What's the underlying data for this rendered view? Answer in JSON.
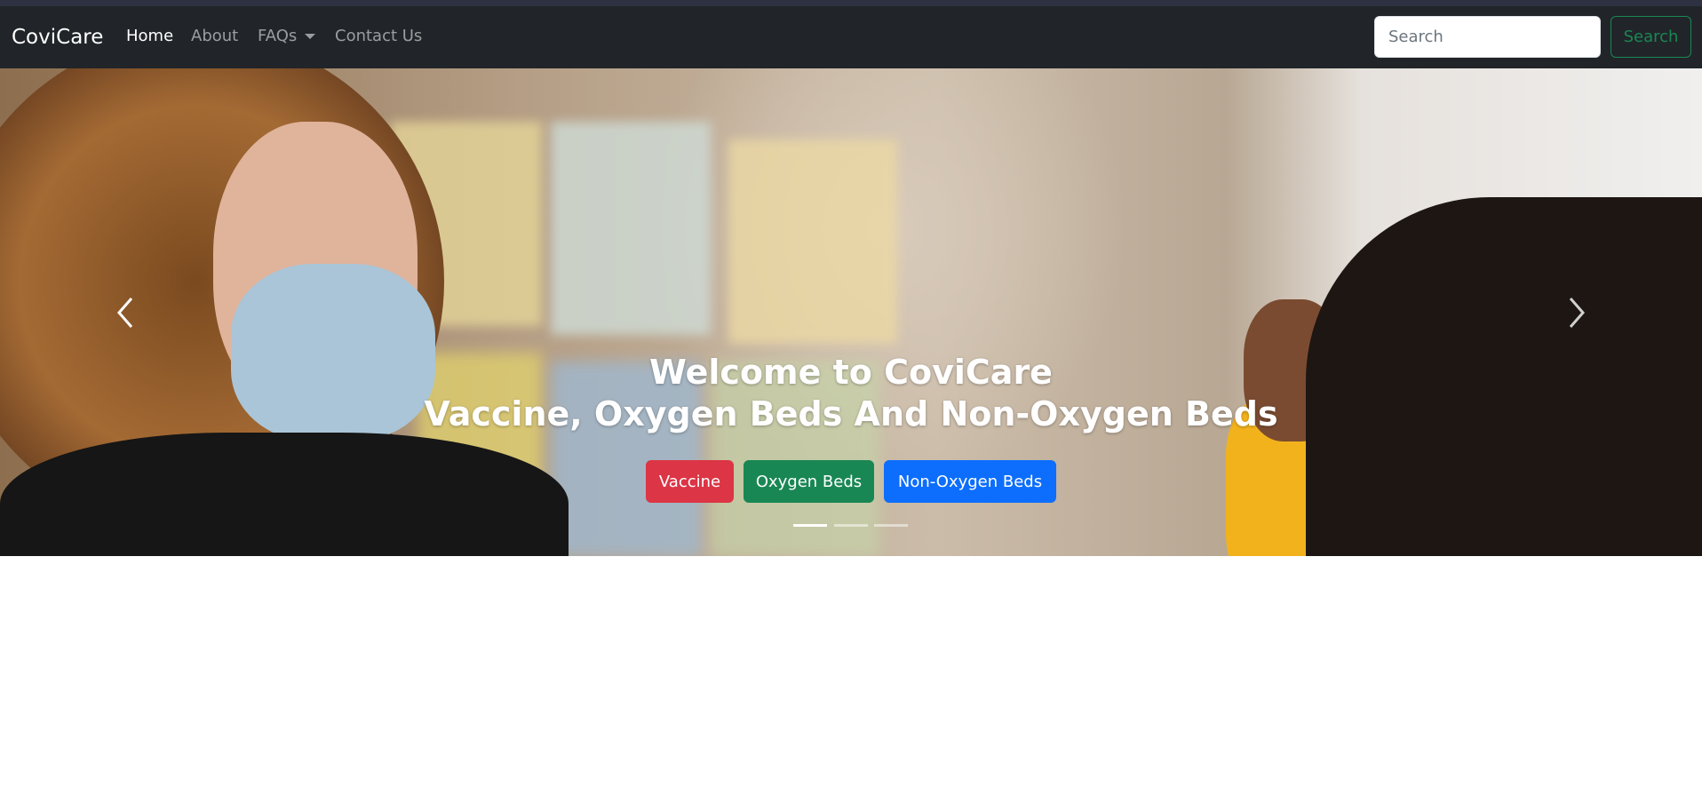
{
  "navbar": {
    "brand": "CoviCare",
    "links": [
      {
        "label": "Home",
        "active": true
      },
      {
        "label": "About"
      },
      {
        "label": "FAQs"
      },
      {
        "label": "Contact Us"
      }
    ],
    "search_placeholder": "Search",
    "search_button": "Search"
  },
  "carousel": {
    "title_line1": "Welcome to CoviCare",
    "title_line2": "Vaccine, Oxygen Beds And Non-Oxygen Beds",
    "buttons": [
      {
        "label": "Vaccine",
        "color": "#dc3545"
      },
      {
        "label": "Oxygen Beds",
        "color": "#198754"
      },
      {
        "label": "Non-Oxygen Beds",
        "color": "#0d6efd"
      }
    ],
    "active_slide": 1,
    "slide_count": 3,
    "prev_icon": "chevron-left-icon",
    "next_icon": "chevron-right-icon"
  }
}
